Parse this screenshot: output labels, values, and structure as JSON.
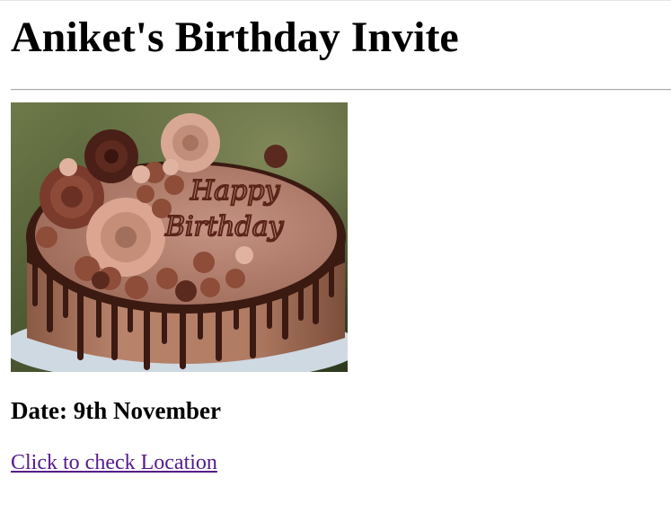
{
  "page": {
    "title": "Aniket's Birthday Invite"
  },
  "image": {
    "alt": "birthday-cake",
    "cake_text_line1": "Happy",
    "cake_text_line2": "Birthday"
  },
  "details": {
    "date": "Date: 9th November"
  },
  "links": {
    "location": "Click to check Location"
  },
  "colors": {
    "link_visited": "#551a8b",
    "divider": "#a8a8a8"
  }
}
